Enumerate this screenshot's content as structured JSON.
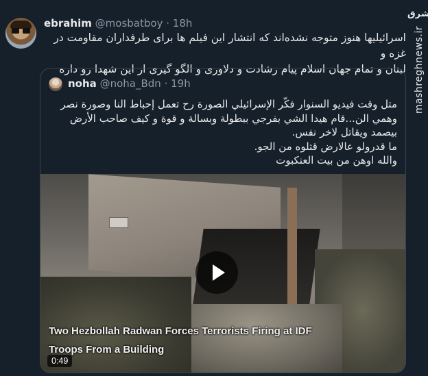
{
  "tweet": {
    "display_name": "ebrahim",
    "handle": "@mosbatboy",
    "separator": "·",
    "time": "18h",
    "text_lines": [
      "اسرائیلیها هنوز متوجه نشده‌اند که انتشار این فیلم ها برای طرفداران مقاومت در غزه و",
      "لبنان و تمام جهان اسلام پیام رشادت و دلاوری و الگو گیری از این شهدا رو داره"
    ]
  },
  "quoted_tweet": {
    "display_name": "noha",
    "handle": "@noha_Bdn",
    "separator": "·",
    "time": "19h",
    "text_lines": [
      "متل وقت فيديو السنوار فكّر الإسرائيلي الصورة رح تعمل إحباط النا وصورة نصر",
      "وهمي الن...قام هيدا الشي بفرجي ببطولة وبسالة و قوة و كيف صاحب الأرض",
      "بيصمد ويقاتل لاخر نفس.",
      "ما قدرولو عالارض قتلوه من الجو.",
      "والله اوهن من بيت العنكبوت"
    ],
    "video": {
      "caption_line1": "Two Hezbollah Radwan Forces Terrorists Firing at IDF",
      "caption_line2": "Troops From a Building",
      "duration": "0:49",
      "play_icon": "play-icon"
    }
  },
  "watermark": {
    "logo_text": "مشرق",
    "site": "mashreghnews.ir"
  }
}
